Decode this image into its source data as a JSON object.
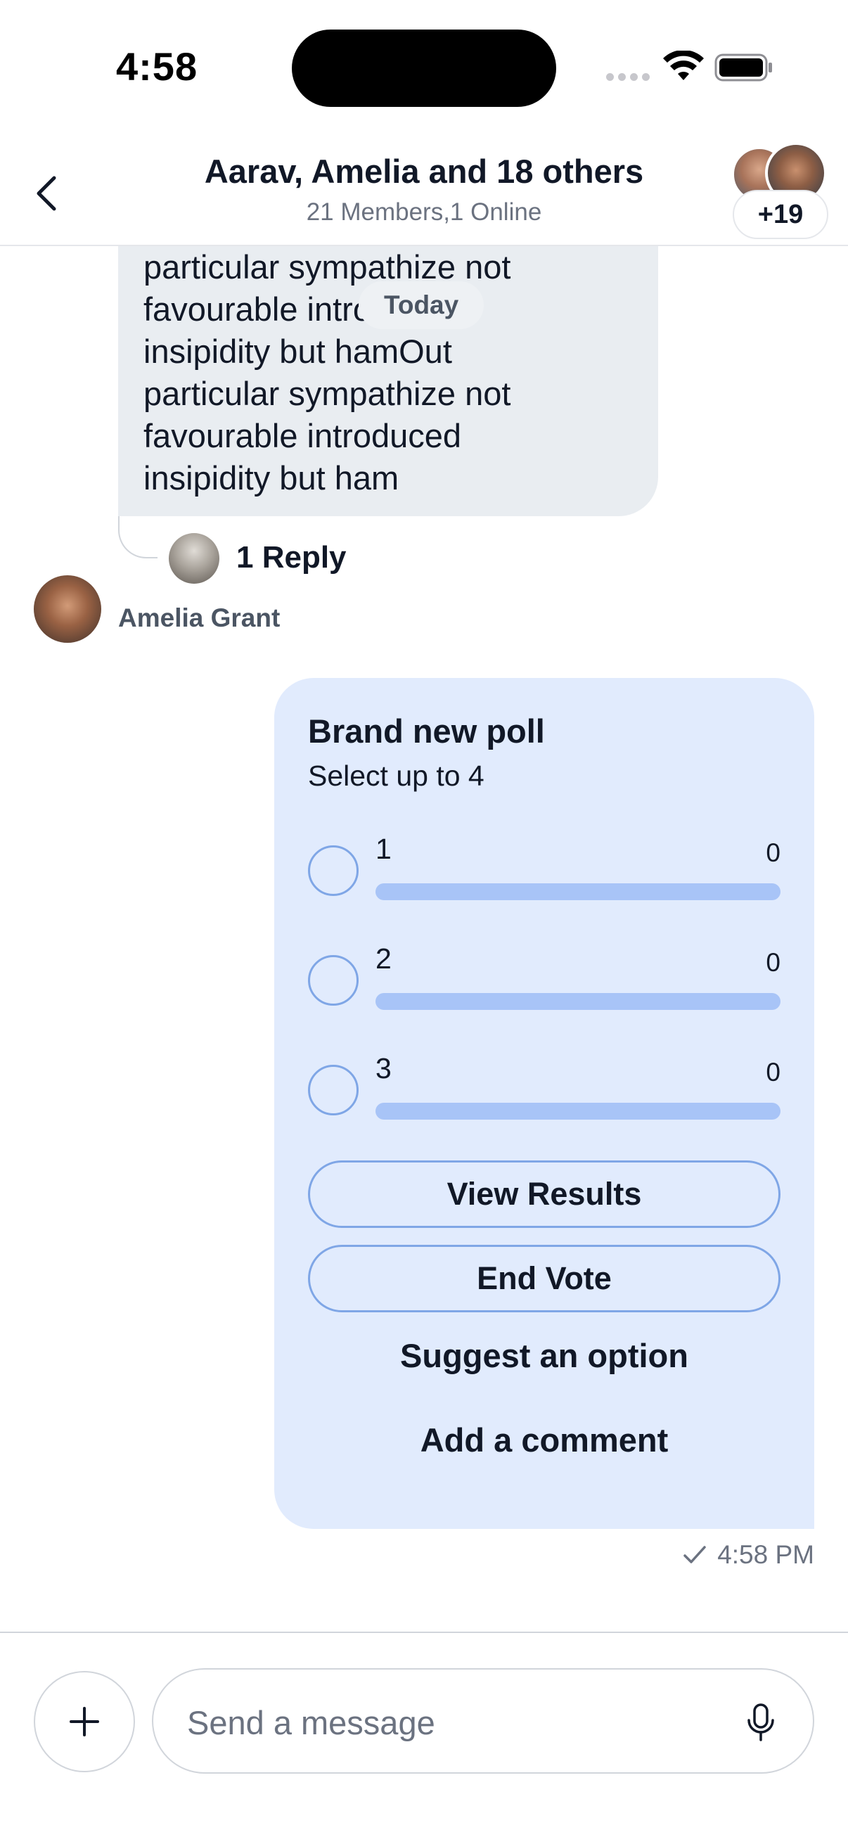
{
  "status_bar": {
    "time": "4:58"
  },
  "header": {
    "title": "Aarav, Amelia and 18 others",
    "subtitle": "21 Members,1 Online",
    "member_badge": "+19"
  },
  "messages": {
    "incoming": {
      "text": "particular sympathize not\nfavourable introduced\ninsipidity but hamOut\nparticular sympathize not\nfavourable introduced\ninsipidity but ham"
    },
    "date_chip": "Today",
    "reply_count": "1 Reply",
    "author_name": "Amelia Grant"
  },
  "poll": {
    "title": "Brand new poll",
    "subtitle": "Select up to 4",
    "options": [
      {
        "label": "1",
        "votes": "0",
        "fill_fraction": 0
      },
      {
        "label": "2",
        "votes": "0",
        "fill_fraction": 0
      },
      {
        "label": "3",
        "votes": "0",
        "fill_fraction": 0
      }
    ],
    "view_results_label": "View Results",
    "end_vote_label": "End Vote",
    "suggest_label": "Suggest an option",
    "comment_label": "Add a comment"
  },
  "message_status": {
    "time": "4:58 PM",
    "icon": "check-icon"
  },
  "composer": {
    "placeholder": "Send a message",
    "attach_icon": "plus-icon",
    "mic_icon": "microphone-icon"
  },
  "colors": {
    "poll_background": "#e1ebfd",
    "poll_accent": "#7fa6e6",
    "poll_bar": "#a8c4f7",
    "incoming_bubble": "#e9edf1"
  }
}
